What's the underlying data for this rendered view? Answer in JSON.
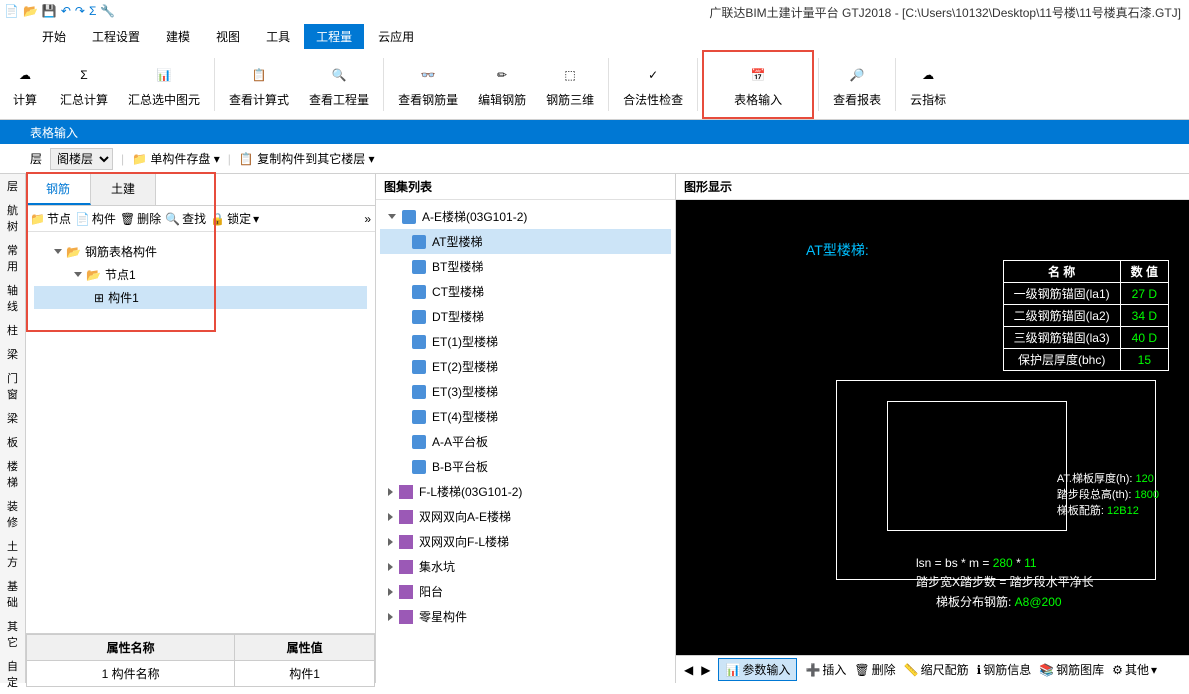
{
  "title": "广联达BIM土建计量平台 GTJ2018 - [C:\\Users\\10132\\Desktop\\11号楼\\11号楼真石漆.GTJ]",
  "menus": [
    "开始",
    "工程设置",
    "建模",
    "视图",
    "工具",
    "工程量",
    "云应用"
  ],
  "menu_active": "工程量",
  "ribbon": [
    {
      "label": "计算"
    },
    {
      "label": "汇总计算"
    },
    {
      "label": "汇总选中图元"
    },
    {
      "label": "查看计算式"
    },
    {
      "label": "查看工程量"
    },
    {
      "label": "查看钢筋量"
    },
    {
      "label": "编辑钢筋"
    },
    {
      "label": "钢筋三维"
    },
    {
      "label": "合法性检查"
    },
    {
      "label": "表格输入"
    },
    {
      "label": "查看报表"
    },
    {
      "label": "云指标"
    }
  ],
  "sub_header": "表格输入",
  "toolbar2": {
    "floor_select": "阁楼层",
    "btn1": "单构件存盘",
    "btn2": "复制构件到其它楼层"
  },
  "left_labels": [
    "层",
    "航树",
    "",
    "常用",
    "轴线",
    "柱",
    "",
    "梁",
    "门窗",
    "梁",
    "",
    "板",
    "楼梯",
    "装修",
    "土方",
    "基础",
    "其它",
    "自定"
  ],
  "panel1": {
    "tabs": [
      "钢筋",
      "土建"
    ],
    "tab_active": "钢筋",
    "toolbar": [
      "节点",
      "构件",
      "删除",
      "查找",
      "锁定"
    ],
    "tree": [
      {
        "label": "钢筋表格构件",
        "icon": "folder",
        "level": 1
      },
      {
        "label": "节点1",
        "icon": "folder",
        "level": 2
      },
      {
        "label": "构件1",
        "icon": "item",
        "level": 3,
        "selected": true
      }
    ]
  },
  "panel2": {
    "header": "图集列表",
    "items": [
      {
        "label": "A-E楼梯(03G101-2)",
        "icon": "book-open",
        "level": 0,
        "expanded": true
      },
      {
        "label": "AT型楼梯",
        "icon": "book",
        "level": 1,
        "selected": true
      },
      {
        "label": "BT型楼梯",
        "icon": "book",
        "level": 1
      },
      {
        "label": "CT型楼梯",
        "icon": "book",
        "level": 1
      },
      {
        "label": "DT型楼梯",
        "icon": "book",
        "level": 1
      },
      {
        "label": "ET(1)型楼梯",
        "icon": "book",
        "level": 1
      },
      {
        "label": "ET(2)型楼梯",
        "icon": "book",
        "level": 1
      },
      {
        "label": "ET(3)型楼梯",
        "icon": "book",
        "level": 1
      },
      {
        "label": "ET(4)型楼梯",
        "icon": "book",
        "level": 1
      },
      {
        "label": "A-A平台板",
        "icon": "book",
        "level": 1
      },
      {
        "label": "B-B平台板",
        "icon": "book",
        "level": 1
      },
      {
        "label": "F-L楼梯(03G101-2)",
        "icon": "purple",
        "level": 0
      },
      {
        "label": "双网双向A-E楼梯",
        "icon": "purple",
        "level": 0
      },
      {
        "label": "双网双向F-L楼梯",
        "icon": "purple",
        "level": 0
      },
      {
        "label": "集水坑",
        "icon": "purple",
        "level": 0
      },
      {
        "label": "阳台",
        "icon": "purple",
        "level": 0
      },
      {
        "label": "零星构件",
        "icon": "purple",
        "level": 0
      }
    ]
  },
  "panel3": {
    "header": "图形显示",
    "graphics_title": "AT型楼梯:",
    "params": [
      {
        "name": "一级钢筋锚固(la1)",
        "value": "27 D"
      },
      {
        "name": "二级钢筋锚固(la2)",
        "value": "34 D"
      },
      {
        "name": "三级钢筋锚固(la3)",
        "value": "40 D"
      },
      {
        "name": "保护层厚度(bhc)",
        "value": "15"
      }
    ],
    "param_headers": [
      "名  称",
      "数  值"
    ],
    "info1_label": "AT.梯板厚度(h):",
    "info1_val": "120",
    "info2_label": "踏步段总高(th):",
    "info2_val": "1800",
    "info3_label": "梯板配筋:",
    "info3_val": "12B12",
    "formula1_a": "lsn = bs * m = ",
    "formula1_b": "280",
    "formula1_c": " * ",
    "formula1_d": "11",
    "formula2": "踏步宽X踏步数 = 踏步段水平净长",
    "formula3_a": "梯板分布钢筋: ",
    "formula3_b": "A8@200"
  },
  "props": {
    "headers": [
      "属性名称",
      "属性值"
    ],
    "rows": [
      {
        "num": "1",
        "name": "构件名称",
        "value": "构件1"
      }
    ]
  },
  "bottom_toolbar": [
    "参数输入",
    "插入",
    "删除",
    "缩尺配筋",
    "钢筋信息",
    "钢筋图库",
    "其他"
  ]
}
